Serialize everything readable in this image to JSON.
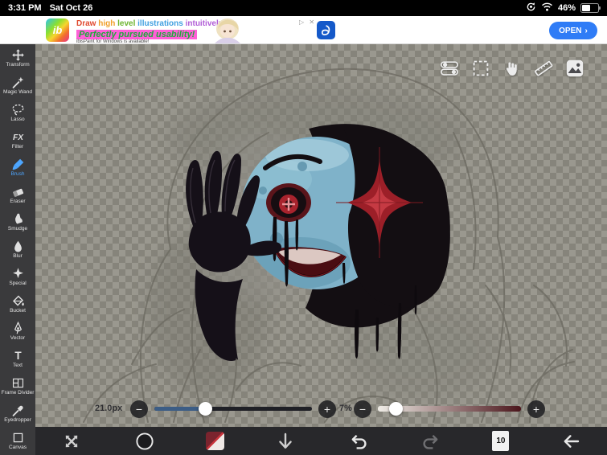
{
  "status_bar": {
    "time": "3:31 PM",
    "date": "Sat Oct 26",
    "battery_percent": "46%"
  },
  "ad_banner": {
    "logo_text": "ib",
    "headline_segments": [
      {
        "text": "Draw ",
        "color": "#e0492f"
      },
      {
        "text": "high ",
        "color": "#f0a02c"
      },
      {
        "text": "level ",
        "color": "#6cb52f"
      },
      {
        "text": "illustrations ",
        "color": "#3f9fe0"
      },
      {
        "text": "intuitively!",
        "color": "#b05cd6"
      }
    ],
    "subheadline": "Perfectly pursued usability!",
    "note": "ibisPaint for Windows is available!",
    "ad_badge": "▷ ✕",
    "open_button_label": "OPEN",
    "open_button_chevron": "›"
  },
  "toolbar": {
    "selected_tool": "Brush",
    "tools": [
      {
        "label": "Transform",
        "icon": "transform-icon"
      },
      {
        "label": "Magic Wand",
        "icon": "magic-wand-icon"
      },
      {
        "label": "Lasso",
        "icon": "lasso-icon"
      },
      {
        "label": "Filter",
        "icon": "filter-icon",
        "badge": "FX"
      },
      {
        "label": "Brush",
        "icon": "brush-icon"
      },
      {
        "label": "Eraser",
        "icon": "eraser-icon"
      },
      {
        "label": "Smudge",
        "icon": "smudge-icon"
      },
      {
        "label": "Blur",
        "icon": "blur-icon"
      },
      {
        "label": "Special",
        "icon": "special-icon"
      },
      {
        "label": "Bucket",
        "icon": "bucket-icon"
      },
      {
        "label": "Vector",
        "icon": "vector-icon"
      },
      {
        "label": "Text",
        "icon": "text-icon",
        "badge": "T"
      },
      {
        "label": "Frame Divider",
        "icon": "frame-divider-icon"
      },
      {
        "label": "Eyedropper",
        "icon": "eyedropper-icon"
      },
      {
        "label": "Canvas",
        "icon": "canvas-icon"
      }
    ]
  },
  "canvas_toolbar": {
    "icons": [
      "quick-settings-icon",
      "selection-icon",
      "hand-icon",
      "ruler-icon",
      "material-icon"
    ]
  },
  "sliders": {
    "brush_size": {
      "label": "21.0px",
      "minus": "−",
      "plus": "+"
    },
    "opacity": {
      "label": "7%",
      "minus": "−",
      "plus": "+"
    }
  },
  "bottom_toolbar": {
    "layers_count": "10"
  },
  "colors": {
    "accent_blue": "#4da6ff",
    "open_button_blue": "#2f7cf6",
    "current_color_dark_red": "#7b242e",
    "slider_fill_blue": "#3c5d85"
  }
}
